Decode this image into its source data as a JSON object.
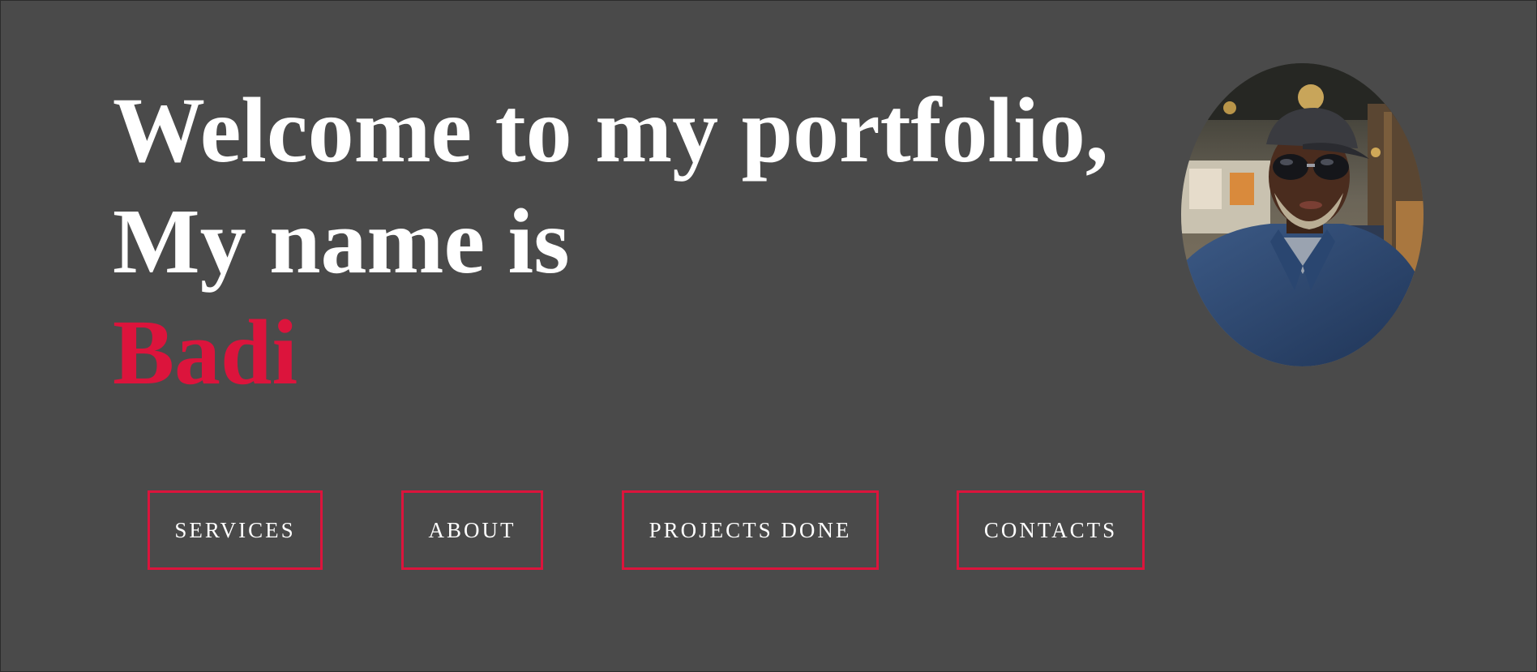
{
  "hero": {
    "line1": "Welcome to my portfolio,",
    "line2": "My name is",
    "name": "Badi"
  },
  "avatar": {
    "icon": "profile-photo"
  },
  "nav": {
    "services": "SERVICES",
    "about": "ABOUT",
    "projects": "PROJECTS DONE",
    "contacts": "CONTACTS"
  },
  "colors": {
    "background": "#4a4a4a",
    "accent": "#dc143c",
    "text": "#ffffff"
  }
}
